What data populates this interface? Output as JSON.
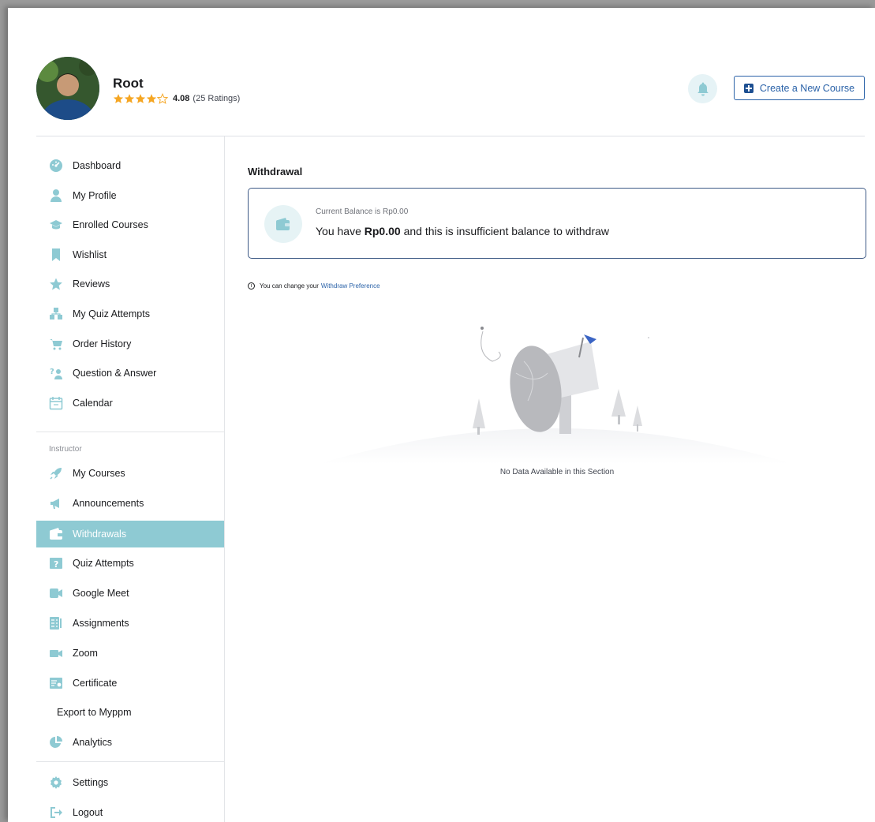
{
  "profile": {
    "name": "Root",
    "rating_value": "4.08",
    "rating_count": "(25 Ratings)",
    "stars_filled": 4,
    "stars_total": 5
  },
  "header": {
    "create_course_label": "Create a New Course"
  },
  "sidebar": {
    "items": [
      {
        "label": "Dashboard",
        "icon": "dashboard-icon"
      },
      {
        "label": "My Profile",
        "icon": "user-icon"
      },
      {
        "label": "Enrolled Courses",
        "icon": "graduation-cap-icon"
      },
      {
        "label": "Wishlist",
        "icon": "bookmark-icon"
      },
      {
        "label": "Reviews",
        "icon": "star-icon"
      },
      {
        "label": "My Quiz Attempts",
        "icon": "quiz-icon"
      },
      {
        "label": "Order History",
        "icon": "cart-icon"
      },
      {
        "label": "Question & Answer",
        "icon": "question-answer-icon"
      },
      {
        "label": "Calendar",
        "icon": "calendar-icon"
      }
    ],
    "instructor_label": "Instructor",
    "instructor_items": [
      {
        "label": "My Courses",
        "icon": "rocket-icon"
      },
      {
        "label": "Announcements",
        "icon": "megaphone-icon"
      },
      {
        "label": "Withdrawals",
        "icon": "wallet-icon",
        "active": true
      },
      {
        "label": "Quiz Attempts",
        "icon": "quiz-question-icon"
      },
      {
        "label": "Google Meet",
        "icon": "video-icon"
      },
      {
        "label": "Assignments",
        "icon": "assignment-icon"
      },
      {
        "label": "Zoom",
        "icon": "zoom-camera-icon"
      },
      {
        "label": "Certificate",
        "icon": "certificate-icon"
      },
      {
        "label": "Export to Myppm",
        "icon": ""
      },
      {
        "label": "Analytics",
        "icon": "pie-chart-icon"
      }
    ],
    "bottom_items": [
      {
        "label": "Settings",
        "icon": "gear-icon"
      },
      {
        "label": "Logout",
        "icon": "logout-icon"
      }
    ]
  },
  "main": {
    "title": "Withdrawal",
    "balance_caption": "Current Balance is Rp0.00",
    "balance_prefix": "You have ",
    "balance_amount": "Rp0.00",
    "balance_suffix": " and this is insufficient balance to withdraw",
    "preference_text": "You can change your",
    "preference_link": "Withdraw Preference",
    "empty_text": "No Data Available in this Section"
  },
  "colors": {
    "accent": "#8ecad3",
    "icon_teal": "#8ecad3",
    "star": "#f5a623",
    "primary_blue": "#2a62a8",
    "card_border": "#3e5a86"
  }
}
